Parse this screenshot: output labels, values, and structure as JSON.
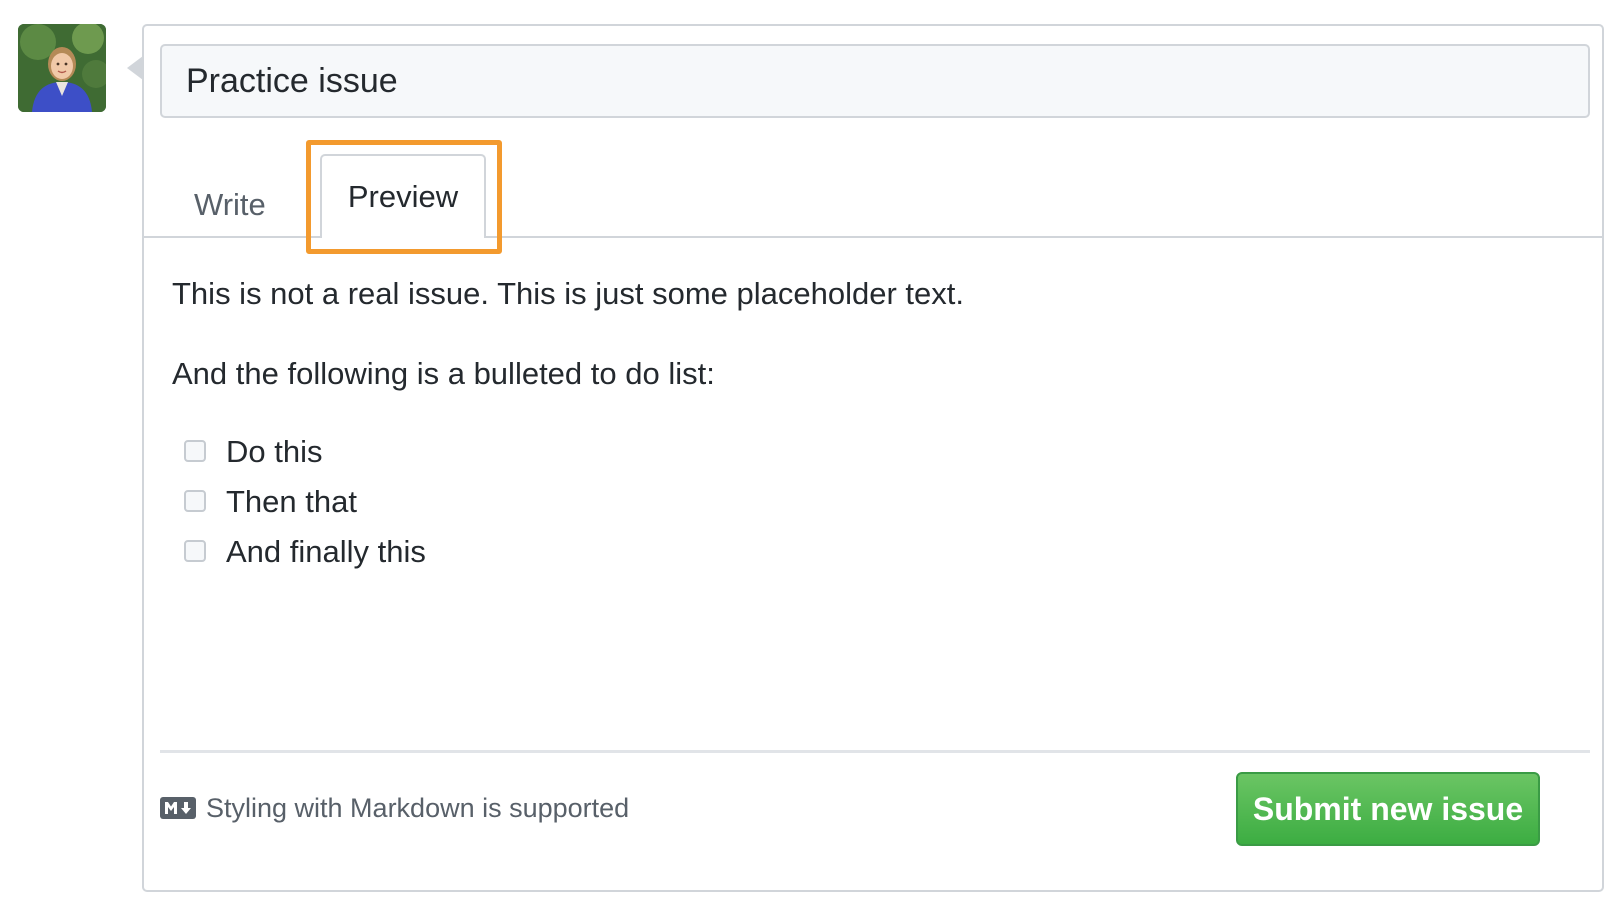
{
  "issue": {
    "title_value": "Practice issue"
  },
  "tabs": [
    {
      "label": "Write",
      "active": false
    },
    {
      "label": "Preview",
      "active": true
    }
  ],
  "preview": {
    "paragraph1": "This is not a real issue. This is just some placeholder text.",
    "paragraph2": "And the following is a bulleted to do list:",
    "tasks": [
      {
        "label": "Do this",
        "checked": false
      },
      {
        "label": "Then that",
        "checked": false
      },
      {
        "label": "And finally this",
        "checked": false
      }
    ]
  },
  "footer": {
    "markdown_hint": "Styling with Markdown is supported",
    "markdown_icon": "markdown-icon",
    "submit_label": "Submit new issue"
  },
  "colors": {
    "accent_highlight": "#f39a2e",
    "submit_green": "#3cad42",
    "border": "#d1d5da"
  }
}
